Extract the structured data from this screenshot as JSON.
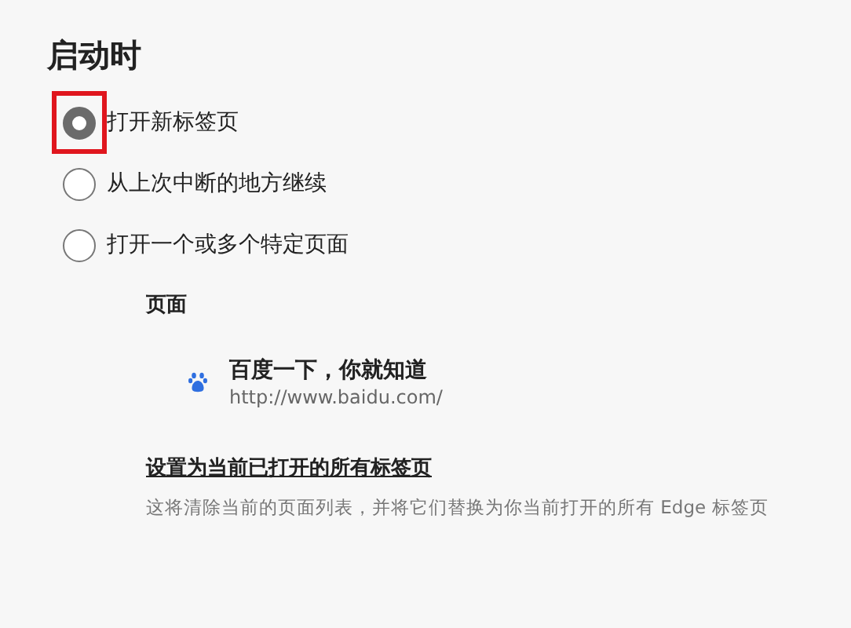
{
  "heading": "启动时",
  "options": [
    {
      "label": "打开新标签页",
      "selected": true,
      "highlighted": true
    },
    {
      "label": "从上次中断的地方继续",
      "selected": false,
      "highlighted": false
    },
    {
      "label": "打开一个或多个特定页面",
      "selected": false,
      "highlighted": false
    }
  ],
  "pages": {
    "title": "页面",
    "items": [
      {
        "title": "百度一下，你就知道",
        "url": "http://www.baidu.com/"
      }
    ]
  },
  "set_current": {
    "link": "设置为当前已打开的所有标签页",
    "description": "这将清除当前的页面列表，并将它们替换为你当前打开的所有 Edge 标签页"
  }
}
